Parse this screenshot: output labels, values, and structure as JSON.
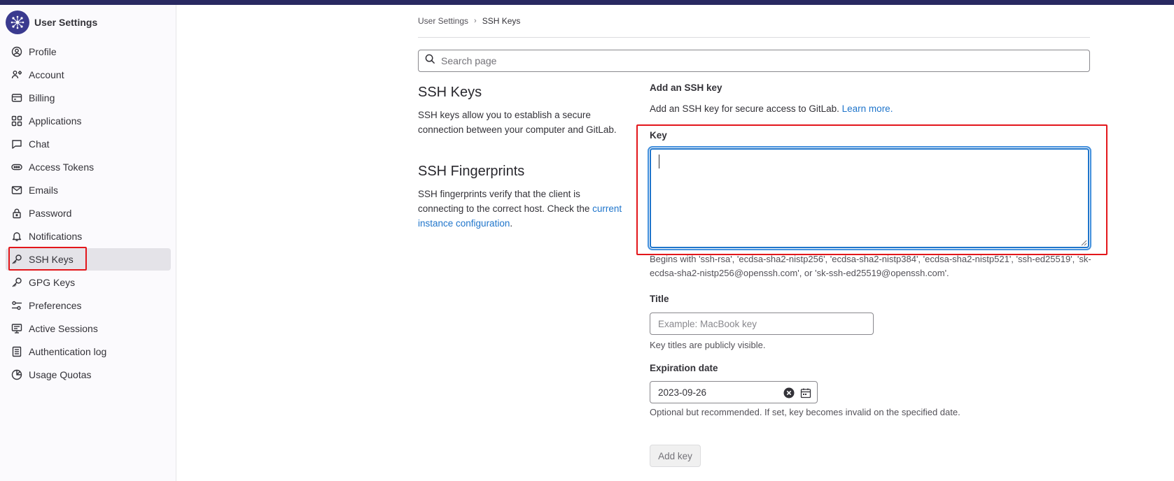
{
  "app": {
    "title": "User Settings"
  },
  "sidebar": {
    "items": [
      {
        "label": "Profile",
        "icon": "profile-icon"
      },
      {
        "label": "Account",
        "icon": "account-icon"
      },
      {
        "label": "Billing",
        "icon": "billing-icon"
      },
      {
        "label": "Applications",
        "icon": "applications-icon"
      },
      {
        "label": "Chat",
        "icon": "chat-icon"
      },
      {
        "label": "Access Tokens",
        "icon": "token-icon"
      },
      {
        "label": "Emails",
        "icon": "mail-icon"
      },
      {
        "label": "Password",
        "icon": "lock-icon"
      },
      {
        "label": "Notifications",
        "icon": "bell-icon"
      },
      {
        "label": "SSH Keys",
        "icon": "key-icon",
        "active": true
      },
      {
        "label": "GPG Keys",
        "icon": "key-icon"
      },
      {
        "label": "Preferences",
        "icon": "preferences-icon"
      },
      {
        "label": "Active Sessions",
        "icon": "monitor-icon"
      },
      {
        "label": "Authentication log",
        "icon": "log-icon"
      },
      {
        "label": "Usage Quotas",
        "icon": "quota-icon"
      }
    ]
  },
  "breadcrumb": {
    "parent": "User Settings",
    "separator": "›",
    "current": "SSH Keys"
  },
  "search": {
    "placeholder": "Search page"
  },
  "ssh_keys_section": {
    "title": "SSH Keys",
    "description": "SSH keys allow you to establish a secure connection between your computer and GitLab."
  },
  "fingerprints_section": {
    "title": "SSH Fingerprints",
    "description": "SSH fingerprints verify that the client is connecting to the correct host. Check the",
    "link": "current instance configuration",
    "suffix": "."
  },
  "form": {
    "heading": "Add an SSH key",
    "intro": "Add an SSH key for secure access to GitLab.",
    "intro_link": "Learn more.",
    "key_label": "Key",
    "key_value": "",
    "key_help": "Begins with 'ssh-rsa', 'ecdsa-sha2-nistp256', 'ecdsa-sha2-nistp384', 'ecdsa-sha2-nistp521', 'ssh-ed25519', 'sk-ecdsa-sha2-nistp256@openssh.com', or 'sk-ssh-ed25519@openssh.com'.",
    "title_label": "Title",
    "title_placeholder": "Example: MacBook key",
    "title_help": "Key titles are publicly visible.",
    "expiration_label": "Expiration date",
    "expiration_value": "2023-09-26",
    "expiration_help": "Optional but recommended. If set, key becomes invalid on the specified date.",
    "submit_label": "Add key"
  },
  "colors": {
    "accent": "#1f75cb",
    "highlight": "#e3161b",
    "topbar": "#292961"
  }
}
